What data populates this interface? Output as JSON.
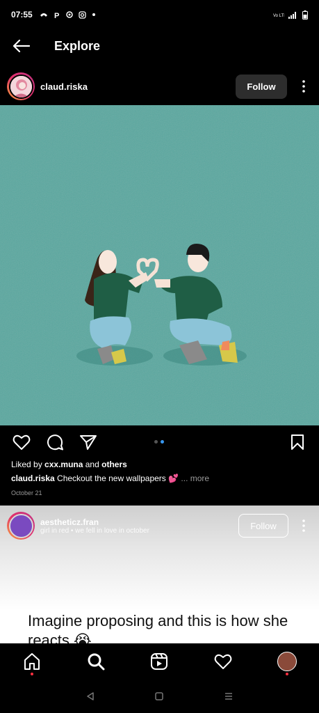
{
  "status": {
    "time": "07:55",
    "icons": [
      "call-icon",
      "p-icon",
      "location-icon",
      "instagram-icon",
      "dot-icon"
    ],
    "right": [
      "volte-icon",
      "signal-icon",
      "battery-icon"
    ]
  },
  "header": {
    "title": "Explore",
    "back_icon": "back-arrow-icon"
  },
  "post": {
    "username": "claud.riska",
    "follow_label": "Follow",
    "likes_prefix": "Liked by",
    "likes_user": "cxx.muna",
    "likes_and": "and",
    "likes_others": "others",
    "caption_user": "claud.riska",
    "caption_text": "Checkout the new wallpapers 💕",
    "caption_more": "... more",
    "date": "October 21",
    "carousel": {
      "count": 2,
      "active": 1
    }
  },
  "next_post": {
    "username": "aestheticz.fran",
    "subtitle": "girl in red • we fell in love in october",
    "follow_label": "Follow",
    "text": "Imagine proposing and this is how she reacts 😭"
  },
  "bottom_nav": [
    "home-icon",
    "search-icon",
    "reels-icon",
    "heart-icon",
    "profile-avatar"
  ],
  "colors": {
    "bg": "#000000",
    "post_bg": "#5aa8a0",
    "accent": "#3897f0",
    "notif": "#ff3040"
  }
}
